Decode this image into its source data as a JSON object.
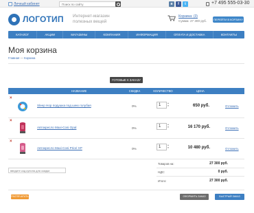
{
  "topbar": {
    "account_link": "Личный кабинет",
    "search_placeholder": "Поиск по сайту",
    "social": [
      "vk-icon",
      "facebook-icon",
      "twitter-icon"
    ],
    "phone": "+7 495 555-03-30"
  },
  "header": {
    "logo": "ЛОГОТИП",
    "slogan_line1": "Интернет-магазин",
    "slogan_line2": "полезных вещей",
    "cart_title": "Корзина: (3)",
    "cart_sum": "Сумма: 27 300 руб.",
    "order_button": "Перейти в корзину"
  },
  "nav": {
    "items": [
      "Каталог",
      "Акции",
      "Магазины",
      "Компания",
      "Информация",
      "Оплата и доставка",
      "Контакты"
    ]
  },
  "page": {
    "title": "Моя корзина",
    "breadcrumb_home": "Главная",
    "breadcrumb_sep": "—",
    "breadcrumb_current": "Корзина",
    "ready_button": "Готовые к заказу"
  },
  "table": {
    "headers": {
      "name": "Название",
      "discount": "Скидка",
      "qty": "Количество",
      "price": "Цена"
    },
    "rows": [
      {
        "name": "Sleep Hop подушка под шею голубая",
        "discount": "0%",
        "qty": "1",
        "price": "650 руб.",
        "action": "Отложить",
        "delete": "×"
      },
      {
        "name": "Автокресло Maxi-Cosi Opal",
        "discount": "0%",
        "qty": "1",
        "price": "16 170 руб.",
        "action": "Отложить",
        "delete": "×"
      },
      {
        "name": "Автокресло Maxi-Cosi Priori XP",
        "discount": "0%",
        "qty": "1",
        "price": "10 480 руб.",
        "action": "Отложить",
        "delete": "×"
      }
    ]
  },
  "coupon": {
    "placeholder": "введите код купона для скидки"
  },
  "totals": {
    "goods_label": "Товаров на:",
    "goods_value": "27 300 руб.",
    "vat_label": "НДС:",
    "vat_value": "0 руб.",
    "total_label": "Итого:",
    "total_value": "27 300 руб."
  },
  "actions": {
    "print": "Распечатать",
    "checkout": "Оформить заказ",
    "quick": "Быстрый заказ"
  },
  "colors": {
    "brand": "#3d7fc2",
    "accent": "#f09a35",
    "delete": "#c0392b"
  }
}
